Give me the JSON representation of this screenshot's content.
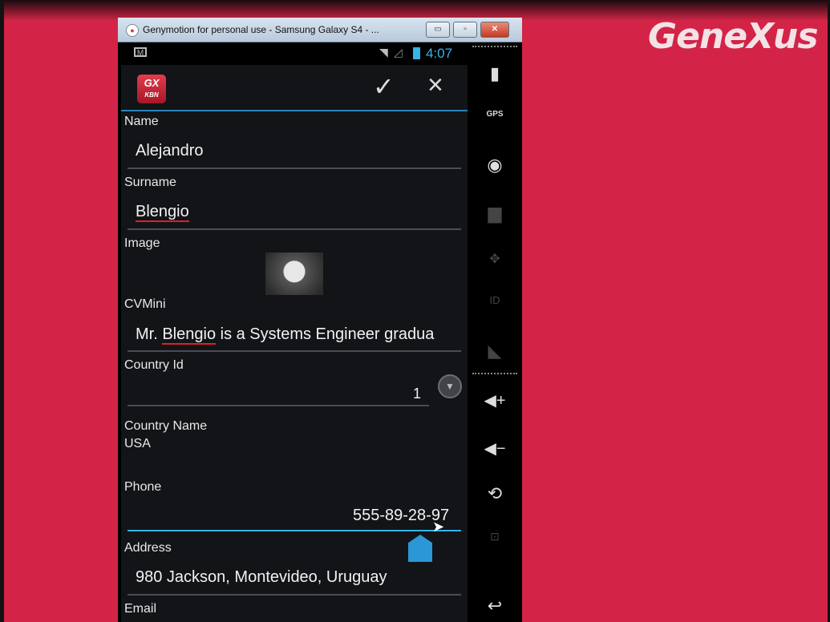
{
  "window": {
    "title": "Genymotion for personal use - Samsung Galaxy S4 - ...",
    "min_label": "▭",
    "max_label": "▫",
    "close_label": "✕"
  },
  "status_bar": {
    "time": "4:07"
  },
  "app": {
    "icon_text": "GX",
    "icon_sub": "KBN"
  },
  "brand": {
    "logo": "GeneXus"
  },
  "form": {
    "name_label": "Name",
    "name_value": "Alejandro",
    "surname_label": "Surname",
    "surname_value": "Blengio",
    "image_label": "Image",
    "cvmini_label": "CVMini",
    "cvmini_prefix": "Mr. ",
    "cvmini_highlight": "Blengio",
    "cvmini_suffix": " is a Systems Engineer gradua",
    "country_id_label": "Country Id",
    "country_id_value": "1",
    "country_name_label": "Country Name",
    "country_name_value": "USA",
    "phone_label": "Phone",
    "phone_value": "555-89-28-97",
    "address_label": "Address",
    "address_value": "980 Jackson, Montevideo, Uruguay",
    "email_label": "Email"
  },
  "toolbar": {
    "gps_label": "GPS",
    "id_label": "ID",
    "vol_up": "◀+",
    "vol_down": "◀−",
    "back": "↩"
  },
  "colors": {
    "accent": "#33b5e5",
    "brand_bg": "#d32447"
  }
}
